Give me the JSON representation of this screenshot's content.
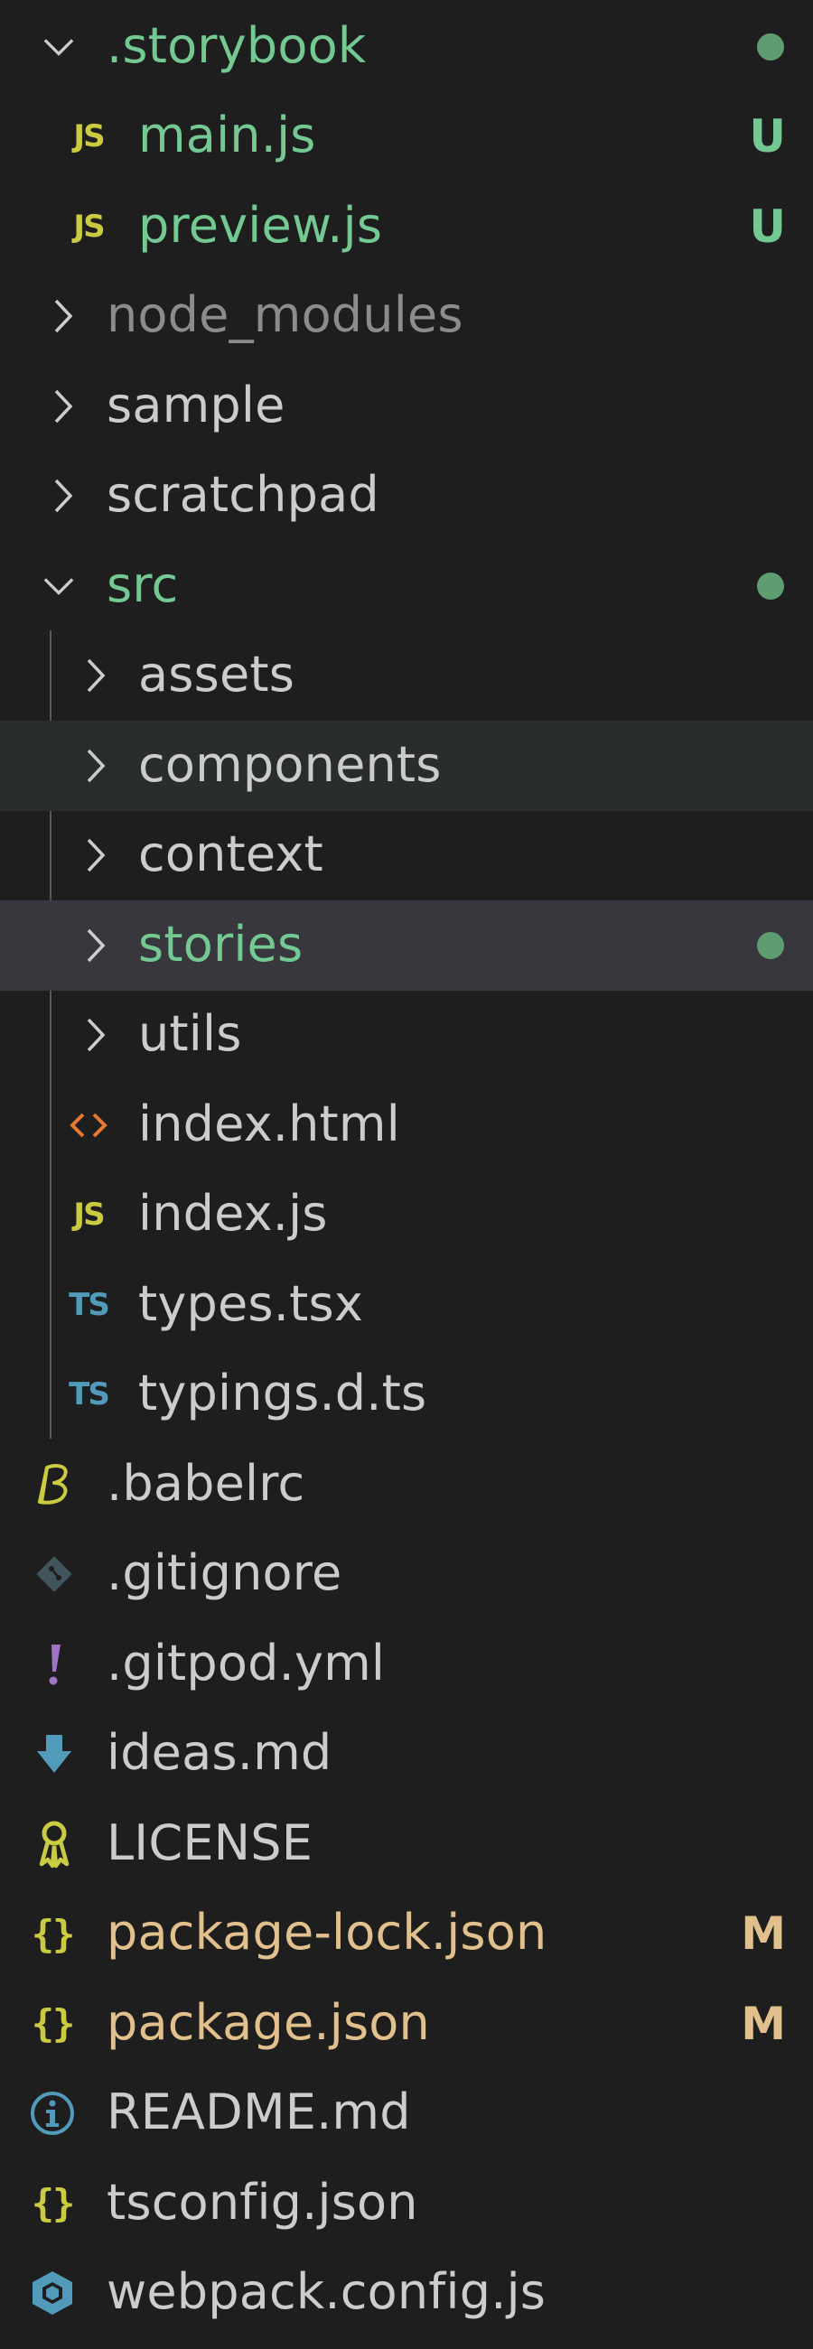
{
  "colors": {
    "background": "#1e1e1e",
    "text_default": "#cccccc",
    "text_ignored": "#8c8c8c",
    "git_untracked": "#73c991",
    "git_modified": "#e2c08d",
    "git_dot": "#5f9c6f",
    "hover_row": "#2a2d2e",
    "selected_row": "#37373d"
  },
  "explorer": {
    "items": [
      {
        "label": ".storybook",
        "kind": "folder-open",
        "icon": "chevron-down-icon",
        "status_dot": true
      },
      {
        "label": "main.js",
        "kind": "file",
        "icon": "javascript-file-icon",
        "badge": "JS",
        "status": "U"
      },
      {
        "label": "preview.js",
        "kind": "file",
        "icon": "javascript-file-icon",
        "badge": "JS",
        "status": "U"
      },
      {
        "label": "node_modules",
        "kind": "folder",
        "icon": "chevron-right-icon"
      },
      {
        "label": "sample",
        "kind": "folder",
        "icon": "chevron-right-icon"
      },
      {
        "label": "scratchpad",
        "kind": "folder",
        "icon": "chevron-right-icon"
      },
      {
        "label": "src",
        "kind": "folder-open",
        "icon": "chevron-down-icon",
        "status_dot": true
      },
      {
        "label": "assets",
        "kind": "folder",
        "icon": "chevron-right-icon"
      },
      {
        "label": "components",
        "kind": "folder",
        "icon": "chevron-right-icon"
      },
      {
        "label": "context",
        "kind": "folder",
        "icon": "chevron-right-icon"
      },
      {
        "label": "stories",
        "kind": "folder",
        "icon": "chevron-right-icon",
        "status_dot": true
      },
      {
        "label": "utils",
        "kind": "folder",
        "icon": "chevron-right-icon"
      },
      {
        "label": "index.html",
        "kind": "file",
        "icon": "html-file-icon"
      },
      {
        "label": "index.js",
        "kind": "file",
        "icon": "javascript-file-icon",
        "badge": "JS"
      },
      {
        "label": "types.tsx",
        "kind": "file",
        "icon": "typescript-file-icon",
        "badge": "TS"
      },
      {
        "label": "typings.d.ts",
        "kind": "file",
        "icon": "typescript-file-icon",
        "badge": "TS"
      },
      {
        "label": ".babelrc",
        "kind": "file",
        "icon": "babel-file-icon"
      },
      {
        "label": ".gitignore",
        "kind": "file",
        "icon": "git-file-icon"
      },
      {
        "label": ".gitpod.yml",
        "kind": "file",
        "icon": "yaml-exclamation-icon"
      },
      {
        "label": "ideas.md",
        "kind": "file",
        "icon": "markdown-file-icon"
      },
      {
        "label": "LICENSE",
        "kind": "file",
        "icon": "license-file-icon"
      },
      {
        "label": "package-lock.json",
        "kind": "file",
        "icon": "json-file-icon",
        "badge": "{}",
        "status": "M"
      },
      {
        "label": "package.json",
        "kind": "file",
        "icon": "json-file-icon",
        "badge": "{}",
        "status": "M"
      },
      {
        "label": "README.md",
        "kind": "file",
        "icon": "info-file-icon"
      },
      {
        "label": "tsconfig.json",
        "kind": "file",
        "icon": "json-file-icon",
        "badge": "{}"
      },
      {
        "label": "webpack.config.js",
        "kind": "file",
        "icon": "webpack-file-icon"
      }
    ]
  }
}
